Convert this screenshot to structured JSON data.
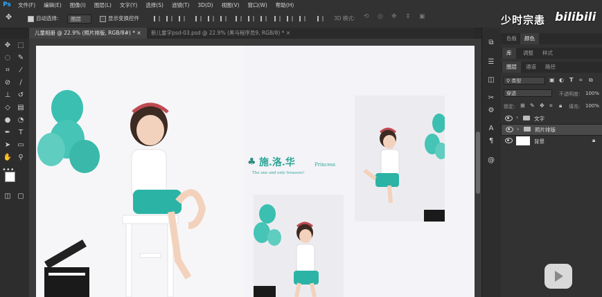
{
  "app": {
    "logo": "Ps"
  },
  "menu": [
    "文件(F)",
    "编辑(E)",
    "图像(I)",
    "图层(L)",
    "文字(Y)",
    "选择(S)",
    "滤镜(T)",
    "3D(D)",
    "视图(V)",
    "窗口(W)",
    "帮助(H)"
  ],
  "options": {
    "auto_select_label": "自动选择:",
    "auto_select_value": "图层",
    "show_transform_label": "显示变换控件",
    "mode_3d_label": "3D 模式:"
  },
  "tabs": [
    {
      "label": "儿童相册 @ 22.9% (照片排版, RGB/8#) *"
    },
    {
      "label": "新儿童字psd-03.psd @ 22.9% (黑马程序员9, RGB/8) *"
    }
  ],
  "canvas": {
    "brand_text": "施.洛.华",
    "brand_en": "Princess",
    "tagline": "The one and only treasure!"
  },
  "panels": {
    "color_tabs": [
      "色板",
      "颜色"
    ],
    "lib_tabs": [
      "库",
      "调整",
      "样式"
    ],
    "layer_tabs": [
      "图层",
      "通道",
      "路径"
    ],
    "filter_label": "类型",
    "blend_mode": "穿透",
    "opacity_label": "不透明度:",
    "opacity_value": "100%",
    "lock_label": "锁定:",
    "fill_label": "填充:",
    "fill_value": "100%",
    "layers": [
      {
        "name": "文字",
        "type": "group",
        "selected": false
      },
      {
        "name": "照片排版",
        "type": "group",
        "selected": true
      },
      {
        "name": "背景",
        "type": "background",
        "selected": false
      }
    ]
  },
  "watermark": {
    "text": "少时宗恚",
    "brand": "bilibili"
  },
  "colors": {
    "accent": "#31a8ff",
    "teal": "#3bbfb0",
    "canvas_bg": "#f4f3f8"
  }
}
